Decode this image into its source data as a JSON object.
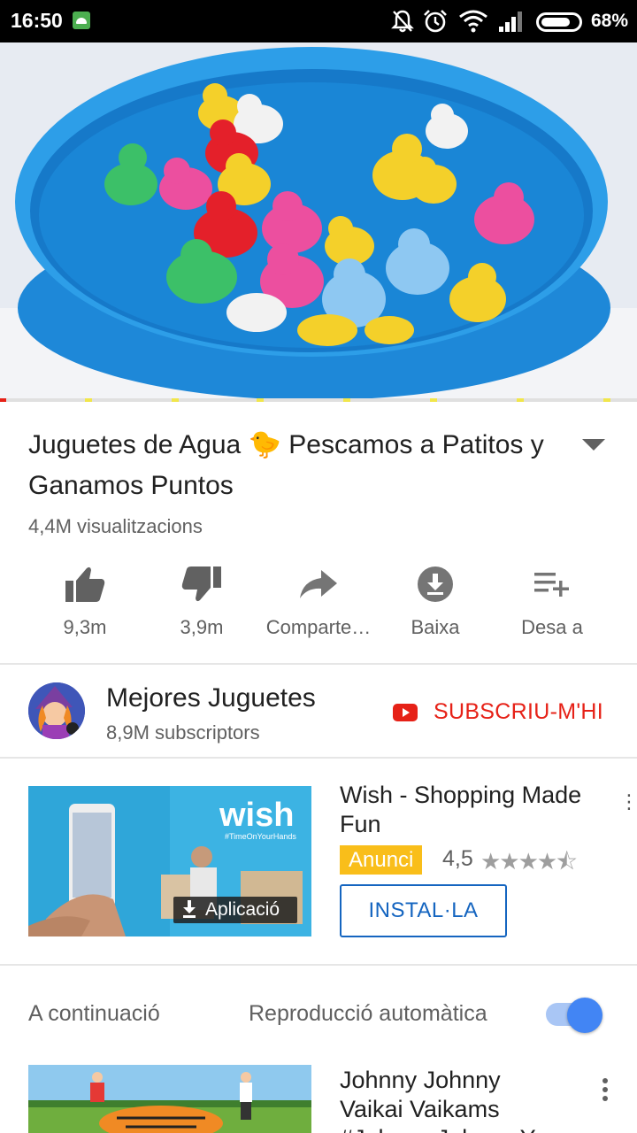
{
  "status_bar": {
    "time": "16:50",
    "battery_percent": "68%",
    "icons": [
      "android-notification-icon",
      "bell-muted-icon",
      "alarm-icon",
      "wifi-icon",
      "signal-icon",
      "battery-icon"
    ]
  },
  "video": {
    "thumbnail_description": "blue-basin-rubber-ducks",
    "progress_fraction": 0.01
  },
  "title": {
    "text_before": "Juguetes de Agua",
    "emoji": "🐤",
    "text_after": "Pescamos a Patitos y Ganamos Puntos",
    "views": "4,4M visualitzacions"
  },
  "actions": [
    {
      "icon": "thumb-up-icon",
      "label": "9,3m"
    },
    {
      "icon": "thumb-down-icon",
      "label": "3,9m"
    },
    {
      "icon": "share-icon",
      "label": "Comparte…"
    },
    {
      "icon": "download-icon",
      "label": "Baixa"
    },
    {
      "icon": "playlist-add-icon",
      "label": "Desa a"
    }
  ],
  "channel": {
    "name": "Mejores Juguetes",
    "subscribers": "8,9M subscriptors",
    "subscribe_label": "SUBSCRIU-M'HI"
  },
  "ad": {
    "title": "Wish - Shopping Made Fun",
    "badge": "Anunci",
    "rating": "4,5",
    "stars": "★★★★⯪",
    "install_label": "INSTAL·LA",
    "thumb_brand": "wish",
    "thumb_tagline": "#TimeOnYourHands",
    "thumb_chip": "Aplicació"
  },
  "up_next": {
    "label": "A continuació",
    "autoplay_label": "Reproducció automàtica",
    "autoplay_on": true,
    "next_title": "Johnny Johnny Vaikai Vaikams #Johnny Johnny Yes"
  },
  "colors": {
    "youtube_red": "#e62117",
    "link_blue": "#1565c0",
    "ad_yellow": "#f9be1a",
    "toggle_blue": "#4285f4"
  }
}
